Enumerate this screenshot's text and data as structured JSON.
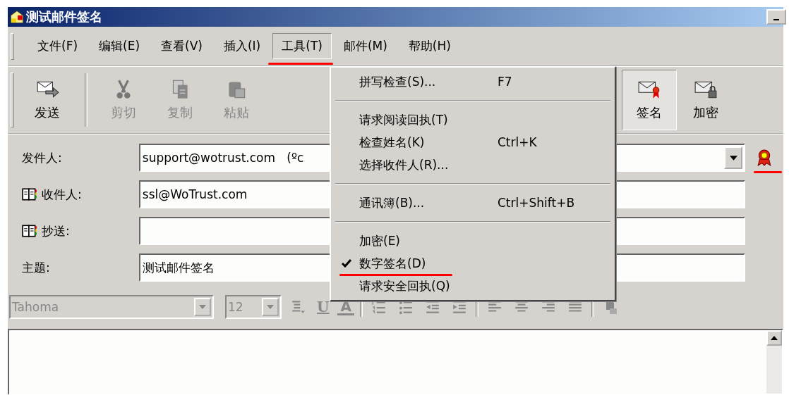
{
  "window": {
    "title": "测试邮件签名"
  },
  "menu_bar": [
    {
      "label": "文件(F)",
      "selected": false,
      "annotated": false
    },
    {
      "label": "编辑(E)",
      "selected": false,
      "annotated": false
    },
    {
      "label": "查看(V)",
      "selected": false,
      "annotated": false
    },
    {
      "label": "插入(I)",
      "selected": false,
      "annotated": false
    },
    {
      "label": "工具(T)",
      "selected": true,
      "annotated": true
    },
    {
      "label": "邮件(M)",
      "selected": false,
      "annotated": false
    },
    {
      "label": "帮助(H)",
      "selected": false,
      "annotated": false
    }
  ],
  "toolbar": [
    {
      "label": "发送",
      "kind": "send",
      "disabled": false,
      "pressed": false
    },
    {
      "label": "剪切",
      "kind": "cut",
      "disabled": true,
      "pressed": false
    },
    {
      "label": "复制",
      "kind": "copy",
      "disabled": true,
      "pressed": false
    },
    {
      "label": "粘贴",
      "kind": "paste",
      "disabled": true,
      "pressed": false
    },
    {
      "label": "签名",
      "kind": "sign",
      "disabled": false,
      "pressed": true
    },
    {
      "label": "加密",
      "kind": "encrypt",
      "disabled": false,
      "pressed": false
    }
  ],
  "tools_menu": [
    {
      "kind": "item",
      "label": "拼写检查(S)...",
      "shortcut": "F7",
      "checked": false,
      "annotated": false
    },
    {
      "kind": "separator"
    },
    {
      "kind": "item",
      "label": "请求阅读回执(T)",
      "checked": false,
      "annotated": false
    },
    {
      "kind": "item",
      "label": "检查姓名(K)",
      "shortcut": "Ctrl+K",
      "checked": false,
      "annotated": false
    },
    {
      "kind": "item",
      "label": "选择收件人(R)...",
      "checked": false,
      "annotated": false
    },
    {
      "kind": "separator"
    },
    {
      "kind": "item",
      "label": "通讯簿(B)...",
      "shortcut": "Ctrl+Shift+B",
      "checked": false,
      "annotated": false
    },
    {
      "kind": "separator"
    },
    {
      "kind": "item",
      "label": "加密(E)",
      "checked": false,
      "annotated": false
    },
    {
      "kind": "item",
      "label": "数字签名(D)",
      "checked": true,
      "annotated": true
    },
    {
      "kind": "item",
      "label": "请求安全回执(Q)",
      "checked": false,
      "annotated": false
    }
  ],
  "fields": [
    {
      "label": "发件人:",
      "kind": "dropdown",
      "value": "support@wotrust.com   (ºc",
      "book": false
    },
    {
      "label": "收件人:",
      "kind": "text",
      "value": "ssl@WoTrust.com",
      "book": true
    },
    {
      "label": "抄送:",
      "kind": "text",
      "book": true
    },
    {
      "label": "主题:",
      "kind": "text",
      "value": "测试邮件签名",
      "book": false
    }
  ],
  "signed_indicator": {
    "annotated": true
  },
  "format_bar": {
    "font": "Tahoma",
    "size": "12",
    "glyphs": [
      {
        "kind": "underline",
        "text": "U"
      },
      {
        "kind": "color",
        "text": "A"
      }
    ]
  }
}
